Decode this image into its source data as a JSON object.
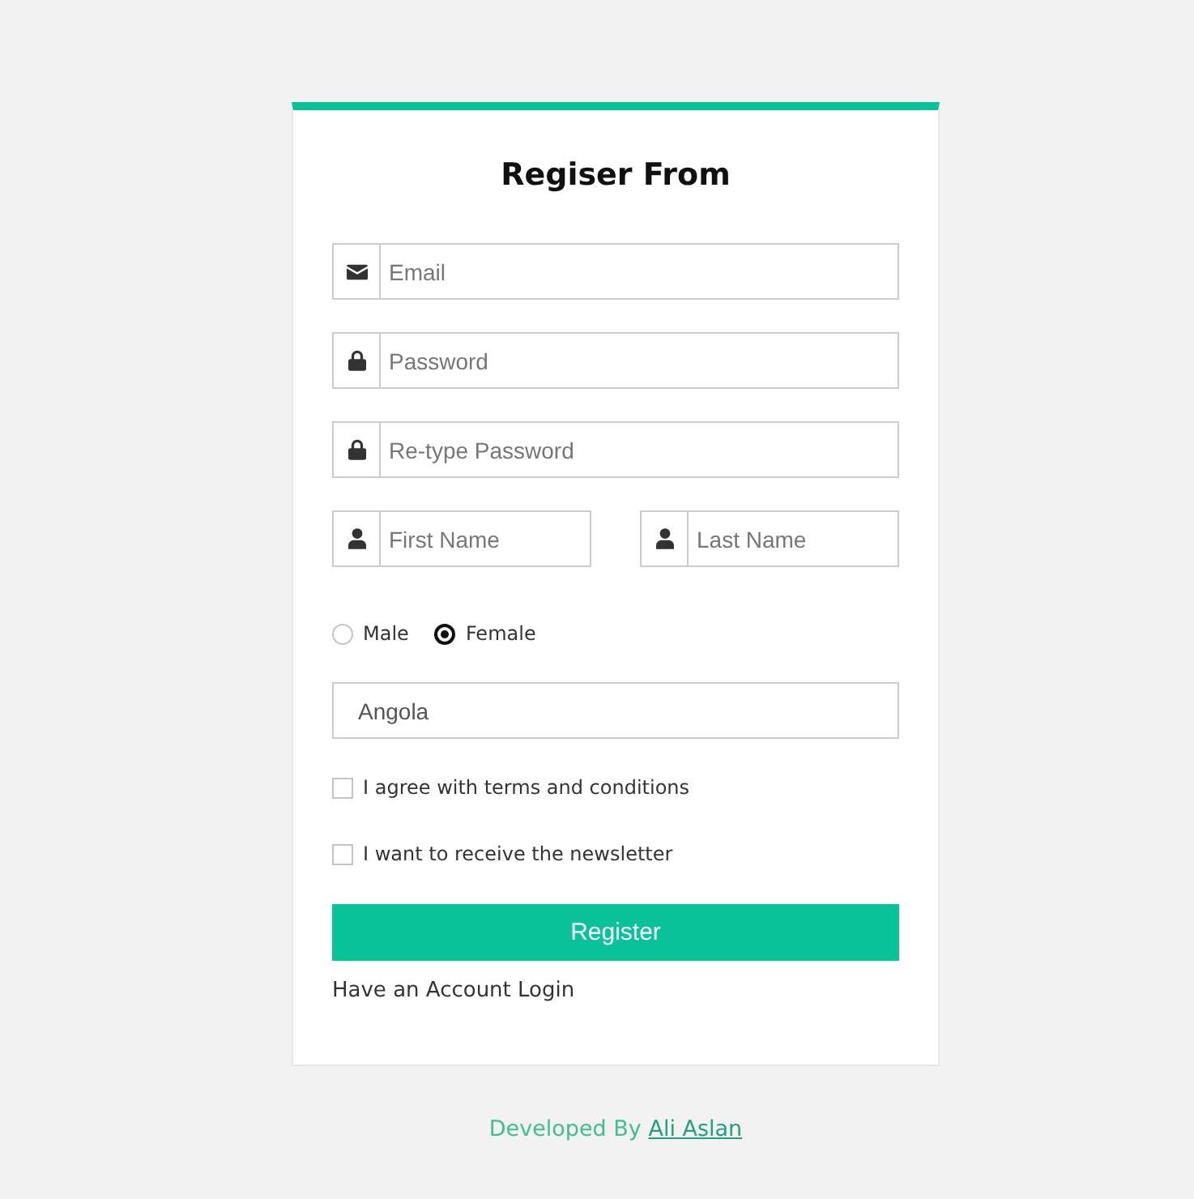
{
  "form": {
    "title": "Regiser From",
    "fields": [
      {
        "kind": "email",
        "placeholder": "Email"
      },
      {
        "kind": "password",
        "placeholder": "Password"
      },
      {
        "kind": "password",
        "placeholder": "Re-type Password"
      }
    ],
    "name_fields": [
      {
        "kind": "person",
        "placeholder": "First Name"
      },
      {
        "kind": "person",
        "placeholder": "Last Name"
      }
    ],
    "gender": [
      {
        "label": "Male",
        "selected": false
      },
      {
        "label": "Female",
        "selected": true
      }
    ],
    "country": {
      "value": "Angola"
    },
    "checkboxes": [
      {
        "label": "I agree with terms and conditions",
        "checked": false
      },
      {
        "label": "I want to receive the newsletter",
        "checked": false
      }
    ],
    "submit": "Register",
    "login_link": "Have an Account Login"
  },
  "footer": {
    "text": "Developed By",
    "link": "Ali Aslan"
  }
}
